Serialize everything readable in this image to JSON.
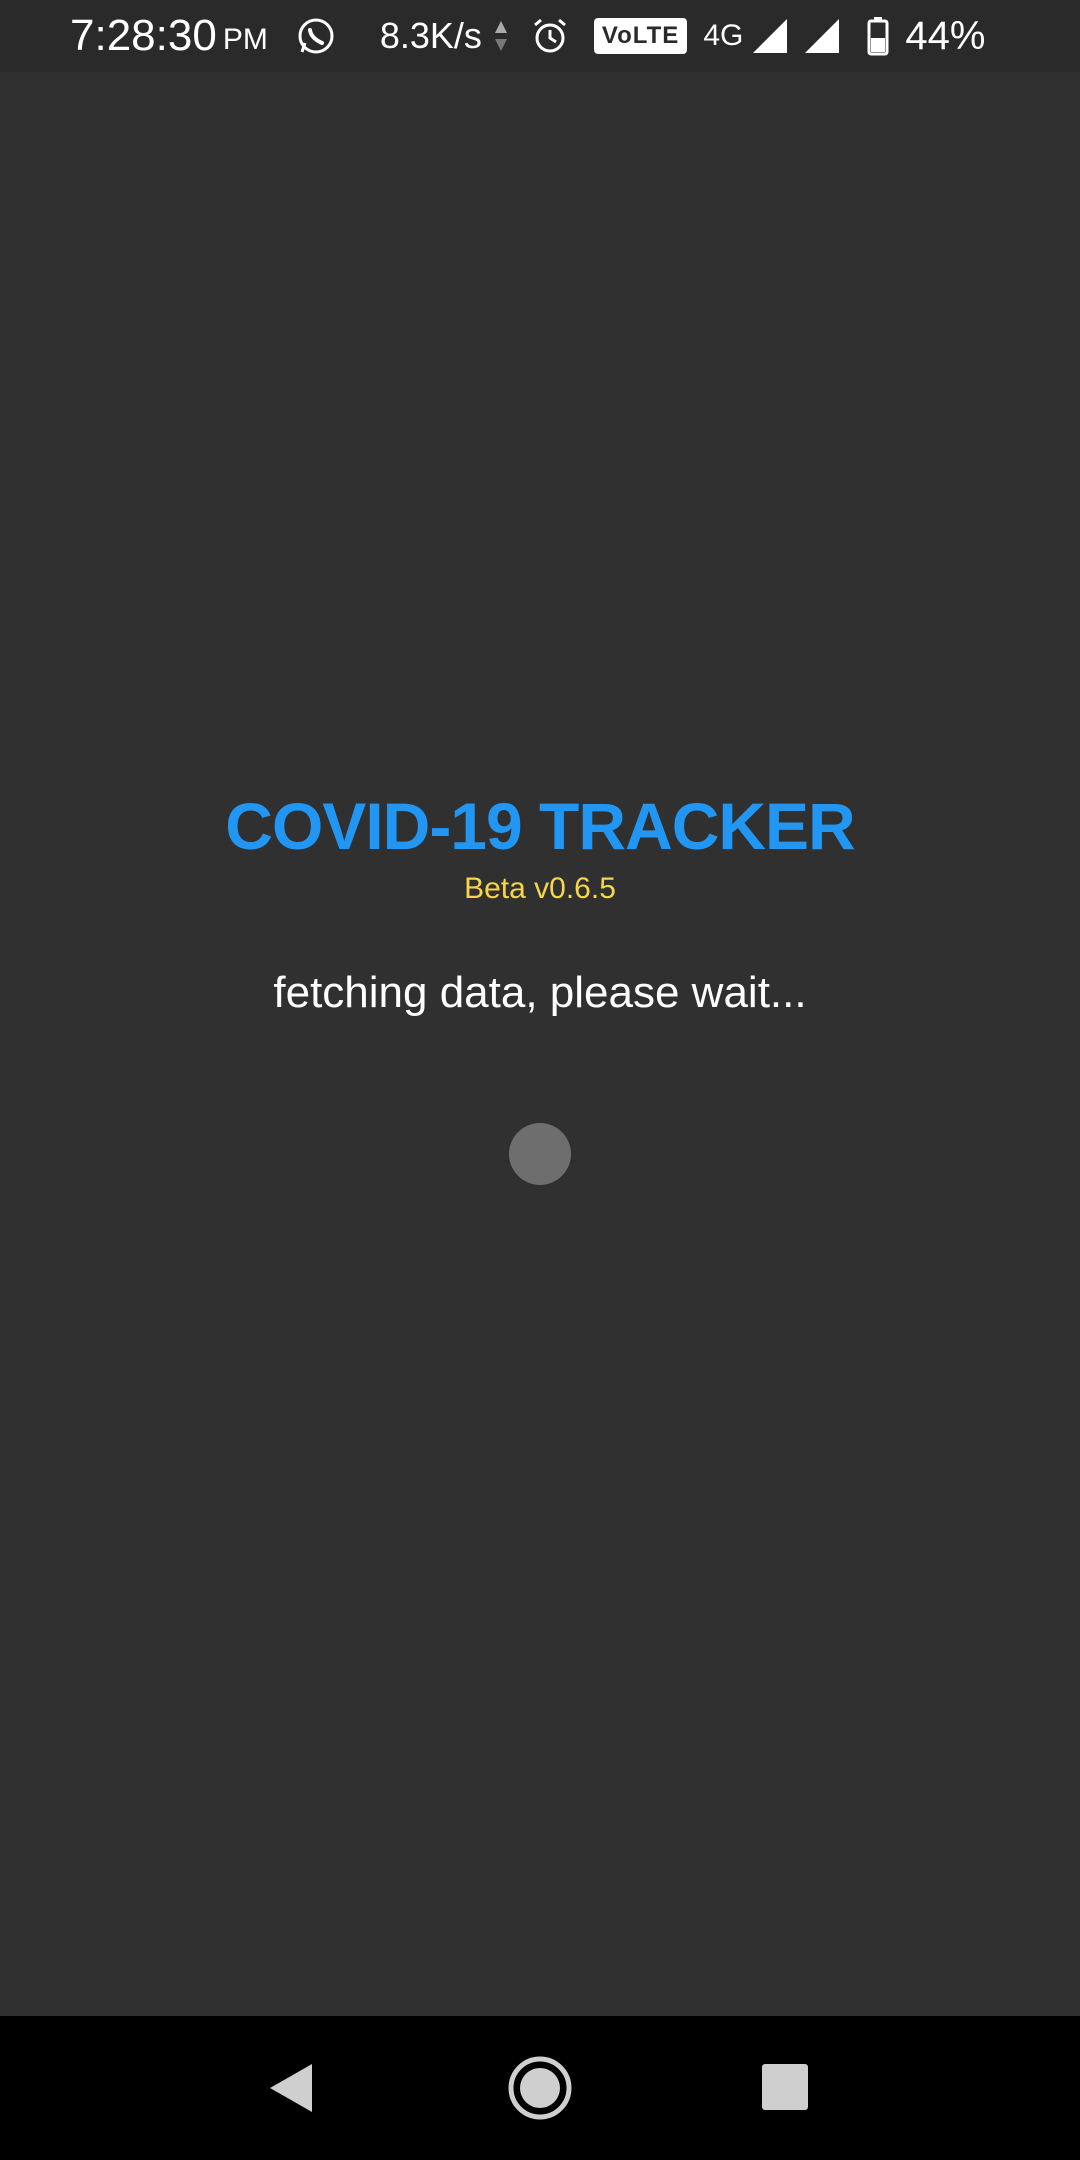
{
  "status_bar": {
    "time": "7:28:30",
    "ampm": "PM",
    "net_speed": "8.3K/s",
    "volte": "VoLTE",
    "network": "4G",
    "battery": "44%",
    "icons": [
      "whatsapp-icon",
      "data-arrows-icon",
      "alarm-icon",
      "signal-icon",
      "battery-icon"
    ]
  },
  "app": {
    "title": "COVID-19 TRACKER",
    "version": "Beta v0.6.5",
    "loading_message": "fetching data, please wait..."
  },
  "colors": {
    "background": "#303030",
    "title": "#2196f3",
    "version": "#f6d54a",
    "message": "#ffffff",
    "spinner": "#6e6e6e"
  },
  "nav_bar": {
    "icons": [
      "back-icon",
      "home-icon",
      "recents-icon"
    ]
  }
}
